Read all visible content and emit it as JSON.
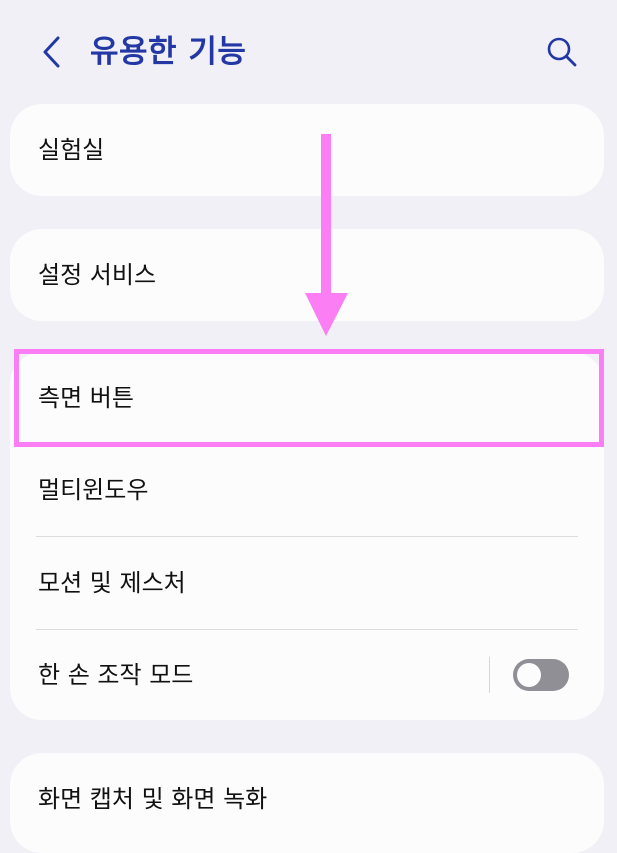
{
  "header": {
    "title": "유용한 기능",
    "back_icon": "chevron-left-icon",
    "search_icon": "search-icon",
    "accent_color": "#2338a5"
  },
  "items": {
    "labs": "실험실",
    "settings_services": "설정 서비스",
    "side_button": "측면 버튼",
    "multi_window": "멀티윈도우",
    "motions_gestures": "모션 및 제스처",
    "one_handed_mode": "한 손 조작 모드",
    "screenshots_recorder": "화면 캡처 및 화면 녹화"
  },
  "toggles": {
    "one_handed_mode": false
  },
  "annotation": {
    "color": "#fb7ef5",
    "arrow": "down-arrow",
    "highlight_target": "측면 버튼"
  }
}
